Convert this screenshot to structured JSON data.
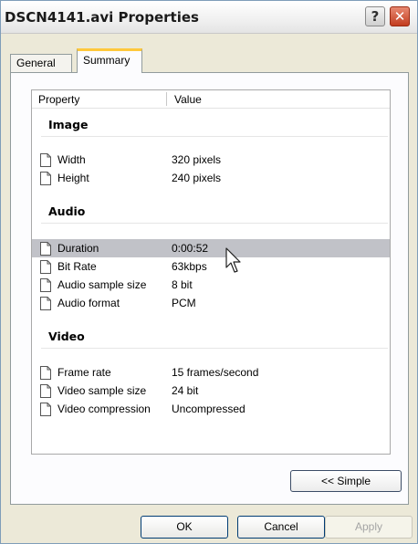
{
  "window": {
    "title": "DSCN4141.avi Properties",
    "help_label": "?",
    "close_label": "✕"
  },
  "tabs": [
    {
      "label": "General"
    },
    {
      "label": "Summary"
    }
  ],
  "list": {
    "columns": {
      "property": "Property",
      "value": "Value"
    },
    "sections": [
      {
        "title": "Image"
      },
      {
        "title": "Audio"
      },
      {
        "title": "Video"
      }
    ],
    "rows": [
      {
        "property": "Width",
        "value": "320 pixels"
      },
      {
        "property": "Height",
        "value": "240 pixels"
      },
      {
        "property": "Duration",
        "value": "0:00:52"
      },
      {
        "property": "Bit Rate",
        "value": "63kbps"
      },
      {
        "property": "Audio sample size",
        "value": "8 bit"
      },
      {
        "property": "Audio format",
        "value": "PCM"
      },
      {
        "property": "Frame rate",
        "value": "15 frames/second"
      },
      {
        "property": "Video sample size",
        "value": "24 bit"
      },
      {
        "property": "Video compression",
        "value": "Uncompressed"
      }
    ],
    "selected_row": "Duration"
  },
  "buttons": {
    "simple": "<< Simple",
    "ok": "OK",
    "cancel": "Cancel",
    "apply": "Apply"
  },
  "icons": {
    "row_icon": "document-icon",
    "cursor": "mouse-pointer-icon"
  },
  "colors": {
    "selected_row": "#c1c2c8",
    "tab_highlight": "#ffc83c",
    "close_button": "#c23c1f"
  }
}
